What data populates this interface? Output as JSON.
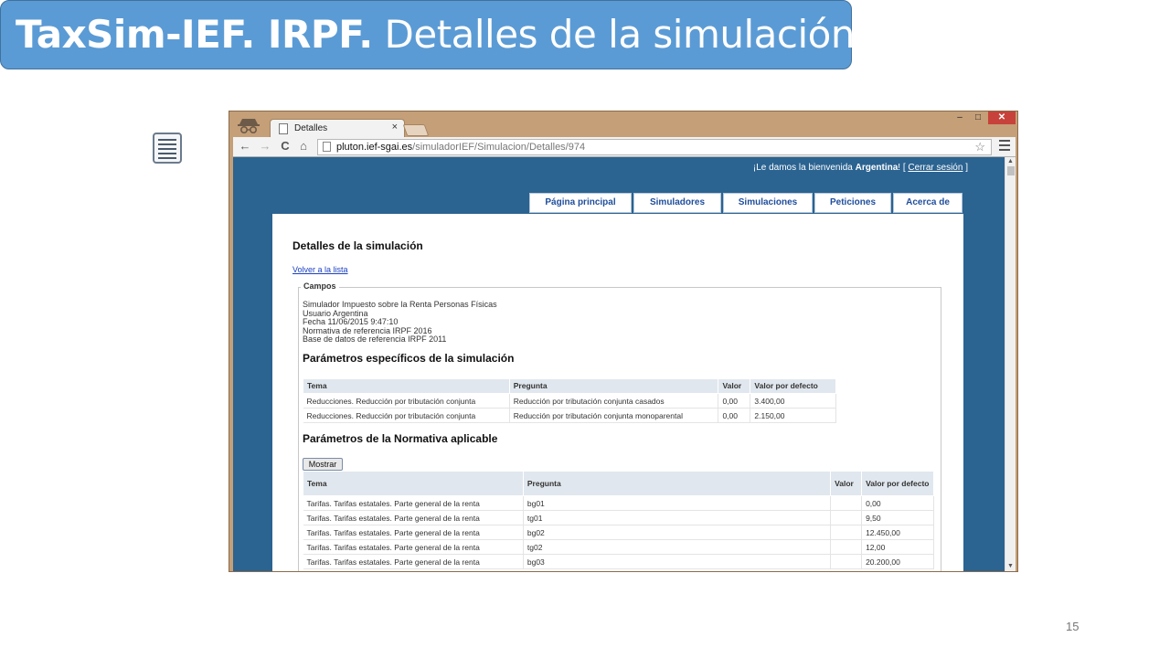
{
  "slide": {
    "title_bold": "TaxSim-IEF. IRPF.",
    "title_rest": " Detalles de la simulación",
    "page_number": "15"
  },
  "browser": {
    "tab_title": "Detalles",
    "tab_close": "×",
    "url_host": "pluton.ief-sgai.es",
    "url_path": "/simuladorIEF/Simulacion/Detalles/974",
    "window_min": "–",
    "window_max": "□",
    "window_close": "✕",
    "back_glyph": "←",
    "forward_glyph": "→",
    "reload_glyph": "C",
    "home_glyph": "⌂",
    "star_glyph": "☆"
  },
  "site": {
    "welcome_prefix": "¡Le damos la bienvenida ",
    "welcome_user": "Argentina",
    "welcome_mid": "! [ ",
    "logout": "Cerrar sesión",
    "welcome_suffix": " ]",
    "menu": [
      "Página principal",
      "Simuladores",
      "Simulaciones",
      "Peticiones",
      "Acerca de"
    ]
  },
  "page": {
    "heading": "Detalles de la simulación",
    "back_link": "Volver a la lista",
    "legend": "Campos",
    "info": [
      "Simulador Impuesto sobre la Renta Personas Físicas",
      "Usuario Argentina",
      "Fecha 11/06/2015 9:47:10",
      "Normativa de referencia IRPF 2016",
      "Base de datos de referencia IRPF 2011"
    ],
    "section1_title": "Parámetros específicos de la simulación",
    "table1": {
      "headers": [
        "Tema",
        "Pregunta",
        "Valor",
        "Valor por defecto"
      ],
      "rows": [
        [
          "Reducciones. Reducción por tributación conjunta",
          "Reducción por tributación conjunta casados",
          "0,00",
          "3.400,00"
        ],
        [
          "Reducciones. Reducción por tributación conjunta",
          "Reducción por tributación conjunta monoparental",
          "0,00",
          "2.150,00"
        ]
      ]
    },
    "section2_title": "Parámetros de la Normativa aplicable",
    "show_button": "Mostrar",
    "table2": {
      "headers": [
        "Tema",
        "Pregunta",
        "Valor",
        "Valor por defecto"
      ],
      "rows": [
        [
          "Tarifas. Tarifas estatales. Parte general de la renta",
          "bg01",
          "",
          "0,00"
        ],
        [
          "Tarifas. Tarifas estatales. Parte general de la renta",
          "tg01",
          "",
          "9,50"
        ],
        [
          "Tarifas. Tarifas estatales. Parte general de la renta",
          "bg02",
          "",
          "12.450,00"
        ],
        [
          "Tarifas. Tarifas estatales. Parte general de la renta",
          "tg02",
          "",
          "12,00"
        ],
        [
          "Tarifas. Tarifas estatales. Parte general de la renta",
          "bg03",
          "",
          "20.200,00"
        ]
      ]
    }
  }
}
